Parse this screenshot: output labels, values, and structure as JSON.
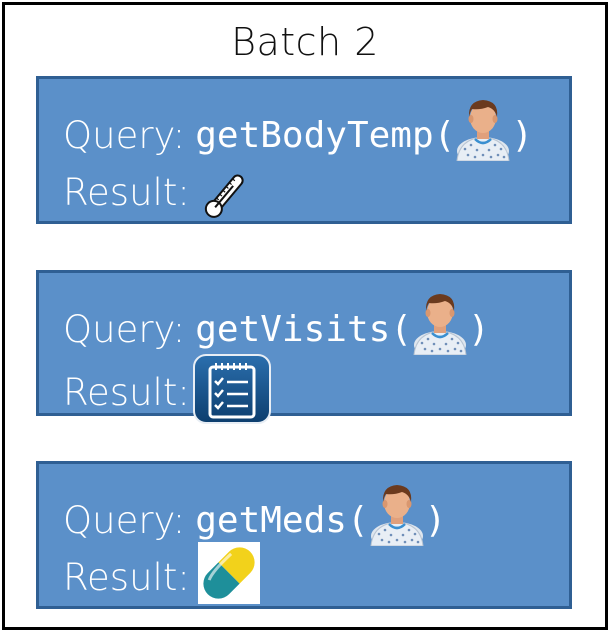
{
  "title": "Batch 2",
  "labels": {
    "query": "Query:",
    "result": "Result:"
  },
  "queries": [
    {
      "function": "getBodyTemp",
      "open_paren": "(",
      "close_paren": ")",
      "arg_icon": "patient-icon",
      "result_icon": "thermometer-icon"
    },
    {
      "function": "getVisits",
      "open_paren": "(",
      "close_paren": ")",
      "arg_icon": "patient-icon",
      "result_icon": "checklist-icon"
    },
    {
      "function": "getMeds",
      "open_paren": "(",
      "close_paren": ")",
      "arg_icon": "patient-icon",
      "result_icon": "pill-icon"
    }
  ],
  "colors": {
    "card_fill": "#5b90c9",
    "card_border": "#2f5f93",
    "text": "#ffffff"
  }
}
